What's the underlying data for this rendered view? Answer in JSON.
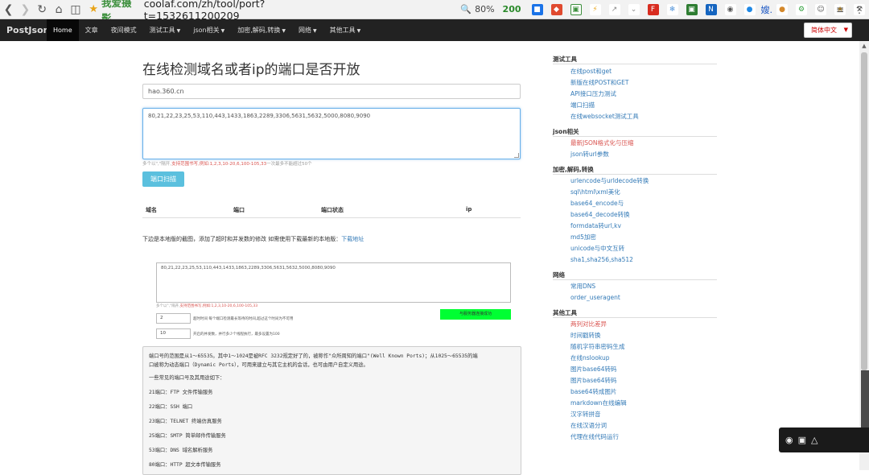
{
  "browser": {
    "site_name": "我爱摄影",
    "url": "coolaf.com/zh/tool/port?t=1532611200209",
    "zoom": "80%",
    "badge_count": "200",
    "ext_text": "嫂."
  },
  "navbar": {
    "brand": "PostJson",
    "items": [
      {
        "label": "Home",
        "active": true
      },
      {
        "label": "文章"
      },
      {
        "label": "夜间模式"
      },
      {
        "label": "测试工具",
        "dropdown": true
      },
      {
        "label": "json相关",
        "dropdown": true
      },
      {
        "label": "加密,解码,转换",
        "dropdown": true
      },
      {
        "label": "网络",
        "dropdown": true
      },
      {
        "label": "其他工具",
        "dropdown": true
      }
    ],
    "language": "简体中文"
  },
  "main": {
    "title": "在线检测域名或者ip的端口是否开放",
    "domain_value": "hao.360.cn",
    "ports_value": "80,21,22,23,25,53,110,443,1433,1863,2289,3306,5631,5632,5000,8080,9090",
    "hint_prefix": "多个以\",\"隔开,",
    "hint_red": "支持范围书写,",
    "hint_example": "例如:1,2,3,10-20,6,100-105,33",
    "hint_suffix": "一次最多不能超过50个",
    "scan_button": "端口扫描",
    "table_headers": [
      "域名",
      "端口",
      "端口状态",
      "ip"
    ],
    "download_note": "下边是本地版的截图，添加了超时和并发数的修改 如需使用下载最新的本地版：",
    "download_link": "下载地址"
  },
  "preview": {
    "ports_value": "80,21,22,23,25,53,110,443,1433,1863,2289,3306,5631,5632,5000,8080,9090",
    "hint_prefix": "多个以\",\"隔开,",
    "hint_red": "支持范围书写,",
    "hint_example": "例如:1,2,3,10-20,6,100-105,33",
    "green_button": "与服务器连接成功",
    "timeout_value": "2",
    "timeout_label": "超时时间 每个端口检测最长等待的时间,超过这个时间为不可用",
    "concurrency_value": "10",
    "concurrency_label": "开启的并发数，并行多少个线程执行，最多设置为100"
  },
  "info": {
    "intro_1": "端口号的范围是从1～65535。其中1～1024是被RFC 3232规定好了的，被称作\"众所周知的端口\"(Well Known Ports)；从1025～65535的端",
    "intro_2": "口被称为动态端口（Dynamic Ports），可用来建立与其它主机的会话，也可由用户自定义用途。",
    "common_title": "一些常见的端口号及其用途如下：",
    "ports": [
      "21端口：FTP 文件传输服务",
      "22端口：SSH 端口",
      "23端口：TELNET 终端仿真服务",
      "25端口：SMTP 简单邮件传输服务",
      "53端口：DNS 域名解析服务",
      "80端口：HTTP 超文本传输服务"
    ]
  },
  "sidebar": {
    "sections": [
      {
        "heading": "测试工具",
        "links": [
          {
            "label": "在线post和get"
          },
          {
            "label": "新版在线POST和GET"
          },
          {
            "label": "API接口压力测试"
          },
          {
            "label": "端口扫描"
          },
          {
            "label": "在线websocket测试工具"
          }
        ]
      },
      {
        "heading": "json相关",
        "links": [
          {
            "label": "最新JSON格式化与压缩",
            "red": true
          },
          {
            "label": "json转url参数"
          }
        ]
      },
      {
        "heading": "加密,解码,转换",
        "links": [
          {
            "label": "urlencode与urldecode转换"
          },
          {
            "label": "sql\\html\\xml美化"
          },
          {
            "label": "base64_encode与"
          },
          {
            "label": "base64_decode转换"
          },
          {
            "label": "formdata转url,kv"
          },
          {
            "label": "md5加密"
          },
          {
            "label": "unicode与中文互转"
          },
          {
            "label": "sha1,sha256,sha512"
          }
        ]
      },
      {
        "heading": "网络",
        "links": [
          {
            "label": "常用DNS"
          },
          {
            "label": "order_useragent"
          }
        ]
      },
      {
        "heading": "其他工具",
        "links": [
          {
            "label": "两列对比差异",
            "red": true
          },
          {
            "label": "时间戳转换"
          },
          {
            "label": "随机字符串密码生成"
          },
          {
            "label": "在线nslookup"
          },
          {
            "label": "图片base64转码"
          },
          {
            "label": "图片base64转码"
          },
          {
            "label": "base64转成图片"
          },
          {
            "label": "markdown在线编辑"
          },
          {
            "label": "汉字转拼音"
          },
          {
            "label": "在线汉语分词"
          },
          {
            "label": "代理在线代码运行"
          }
        ]
      }
    ]
  },
  "colors": {
    "navbar_bg": "#222222",
    "link": "#337ab7",
    "accent_red": "#d9534f",
    "scan_button": "#5bc0de",
    "success_green": "#00ff33"
  }
}
